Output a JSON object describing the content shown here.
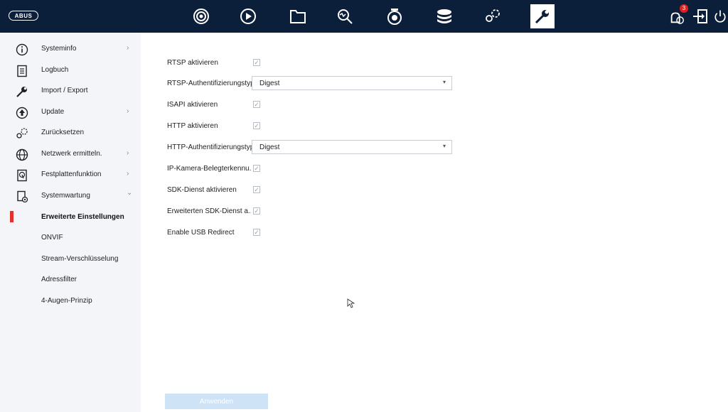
{
  "topbar": {
    "logo": "ABUS",
    "icons": [
      "live-view-icon",
      "playback-icon",
      "file-manager-icon",
      "search-icon",
      "camera-icon",
      "storage-icon",
      "configuration-icon",
      "maintenance-icon"
    ],
    "active_icon": "maintenance-icon",
    "notification_count": "3",
    "right_icons": [
      "alarm-icon",
      "logout-icon",
      "power-icon"
    ]
  },
  "sidebar": {
    "items": [
      {
        "label": "Systeminfo",
        "icon": "info-icon",
        "arrow": "›"
      },
      {
        "label": "Logbuch",
        "icon": "logbook-icon",
        "arrow": ""
      },
      {
        "label": "Import / Export",
        "icon": "wrench-icon",
        "arrow": ""
      },
      {
        "label": "Update",
        "icon": "update-icon",
        "arrow": "›"
      },
      {
        "label": "Zurücksetzen",
        "icon": "reset-icon",
        "arrow": ""
      },
      {
        "label": "Netzwerk ermitteln.",
        "icon": "network-icon",
        "arrow": "›"
      },
      {
        "label": "Festplattenfunktion",
        "icon": "hdd-icon",
        "arrow": "›"
      },
      {
        "label": "Systemwartung",
        "icon": "system-maintenance-icon",
        "arrow": "⌄"
      }
    ],
    "subitems": [
      {
        "label": "Erweiterte Einstellungen",
        "active": true
      },
      {
        "label": "ONVIF",
        "active": false
      },
      {
        "label": "Stream-Verschlüsselung",
        "active": false
      },
      {
        "label": "Adressfilter",
        "active": false
      },
      {
        "label": "4-Augen-Prinzip",
        "active": false
      }
    ]
  },
  "settings": {
    "rtsp_enable": {
      "label": "RTSP aktivieren",
      "checked": true
    },
    "rtsp_auth": {
      "label": "RTSP-Authentifizierungstyp",
      "value": "Digest"
    },
    "isapi_enable": {
      "label": "ISAPI aktivieren",
      "checked": true
    },
    "http_enable": {
      "label": "HTTP aktivieren",
      "checked": true
    },
    "http_auth": {
      "label": "HTTP-Authentifizierungstyp",
      "value": "Digest"
    },
    "ip_camera": {
      "label": "IP-Kamera-Belegterkennu...",
      "checked": true
    },
    "sdk_enable": {
      "label": "SDK-Dienst aktivieren",
      "checked": true
    },
    "sdk_ext": {
      "label": "Erweiterten SDK-Dienst a...",
      "checked": true
    },
    "usb_redirect": {
      "label": "Enable USB Redirect",
      "checked": true
    }
  },
  "apply_label": "Anwenden",
  "colors": {
    "topbar": "#0c1f3a",
    "sidebar": "#f3f5f8",
    "active_marker": "#e53030",
    "apply_button": "#cfe3f7"
  }
}
